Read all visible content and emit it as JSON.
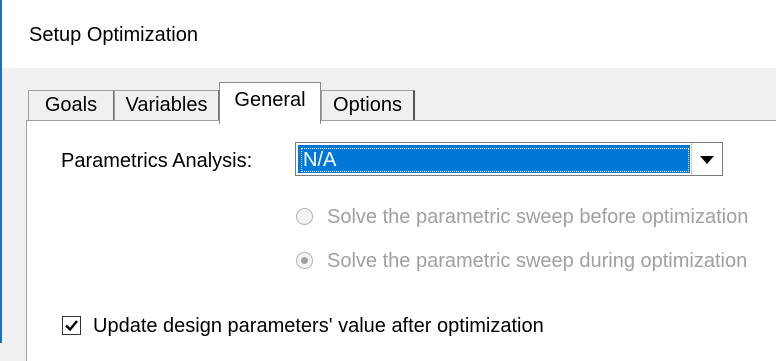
{
  "window": {
    "title": "Setup Optimization",
    "accent_color": "#1f6fbf"
  },
  "tabs": [
    {
      "label": "Goals",
      "selected": false
    },
    {
      "label": "Variables",
      "selected": false
    },
    {
      "label": "General",
      "selected": true
    },
    {
      "label": "Options",
      "selected": false
    }
  ],
  "general": {
    "parametrics_label": "Parametrics Analysis:",
    "parametrics_value": "N/A",
    "selection_color": "#0078d7",
    "radio_before": {
      "label": "Solve the parametric sweep before optimization",
      "checked": false,
      "enabled": false
    },
    "radio_during": {
      "label": "Solve the parametric sweep during optimization",
      "checked": true,
      "enabled": false
    },
    "update_checkbox": {
      "label": "Update design parameters' value after optimization",
      "checked": true
    }
  },
  "icons": {
    "dropdown": "chevron-down-icon",
    "check": "check-icon"
  }
}
